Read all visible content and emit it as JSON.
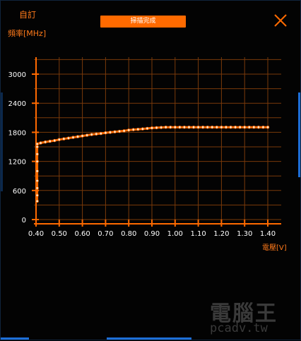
{
  "window": {
    "title": "自訂",
    "status_button": "掃描完成",
    "close_icon": "close-icon",
    "accent_color": "#ff6a00",
    "frame_color": "#1d6fd8"
  },
  "watermark": {
    "main": "電腦王",
    "sub": "pcadv.tw"
  },
  "chart_data": {
    "type": "scatter",
    "ylabel": "頻率[MHz]",
    "xlabel": "電壓[V]",
    "xlim": [
      0.4,
      1.45
    ],
    "ylim": [
      0,
      3300
    ],
    "xticks": [
      "0.40",
      "0.50",
      "0.60",
      "0.70",
      "0.80",
      "0.90",
      "1.00",
      "1.10",
      "1.20",
      "1.30",
      "1.40"
    ],
    "yticks": [
      "3000",
      "2400",
      "1800",
      "1200",
      "600",
      "0"
    ],
    "grid": true,
    "series": [
      {
        "color": "#ff6a00",
        "points": [
          [
            0.405,
            380
          ],
          [
            0.405,
            500
          ],
          [
            0.405,
            650
          ],
          [
            0.405,
            800
          ],
          [
            0.405,
            1000
          ],
          [
            0.405,
            1200
          ],
          [
            0.405,
            1350
          ],
          [
            0.405,
            1500
          ],
          [
            0.405,
            1560
          ],
          [
            0.42,
            1580
          ],
          [
            0.44,
            1600
          ],
          [
            0.46,
            1615
          ],
          [
            0.48,
            1630
          ],
          [
            0.5,
            1650
          ],
          [
            0.52,
            1665
          ],
          [
            0.54,
            1680
          ],
          [
            0.56,
            1695
          ],
          [
            0.58,
            1710
          ],
          [
            0.6,
            1725
          ],
          [
            0.62,
            1740
          ],
          [
            0.64,
            1755
          ],
          [
            0.66,
            1765
          ],
          [
            0.68,
            1775
          ],
          [
            0.7,
            1790
          ],
          [
            0.72,
            1800
          ],
          [
            0.74,
            1810
          ],
          [
            0.76,
            1820
          ],
          [
            0.78,
            1830
          ],
          [
            0.8,
            1845
          ],
          [
            0.82,
            1855
          ],
          [
            0.84,
            1862
          ],
          [
            0.86,
            1870
          ],
          [
            0.88,
            1880
          ],
          [
            0.9,
            1890
          ],
          [
            0.92,
            1895
          ],
          [
            0.94,
            1900
          ],
          [
            0.96,
            1905
          ],
          [
            0.98,
            1905
          ],
          [
            1.0,
            1905
          ],
          [
            1.02,
            1905
          ],
          [
            1.04,
            1905
          ],
          [
            1.06,
            1905
          ],
          [
            1.08,
            1905
          ],
          [
            1.1,
            1905
          ],
          [
            1.12,
            1905
          ],
          [
            1.14,
            1905
          ],
          [
            1.16,
            1905
          ],
          [
            1.18,
            1905
          ],
          [
            1.2,
            1905
          ],
          [
            1.22,
            1905
          ],
          [
            1.24,
            1905
          ],
          [
            1.26,
            1905
          ],
          [
            1.28,
            1905
          ],
          [
            1.3,
            1905
          ],
          [
            1.32,
            1905
          ],
          [
            1.34,
            1905
          ],
          [
            1.36,
            1905
          ],
          [
            1.38,
            1905
          ],
          [
            1.4,
            1905
          ]
        ]
      }
    ]
  }
}
